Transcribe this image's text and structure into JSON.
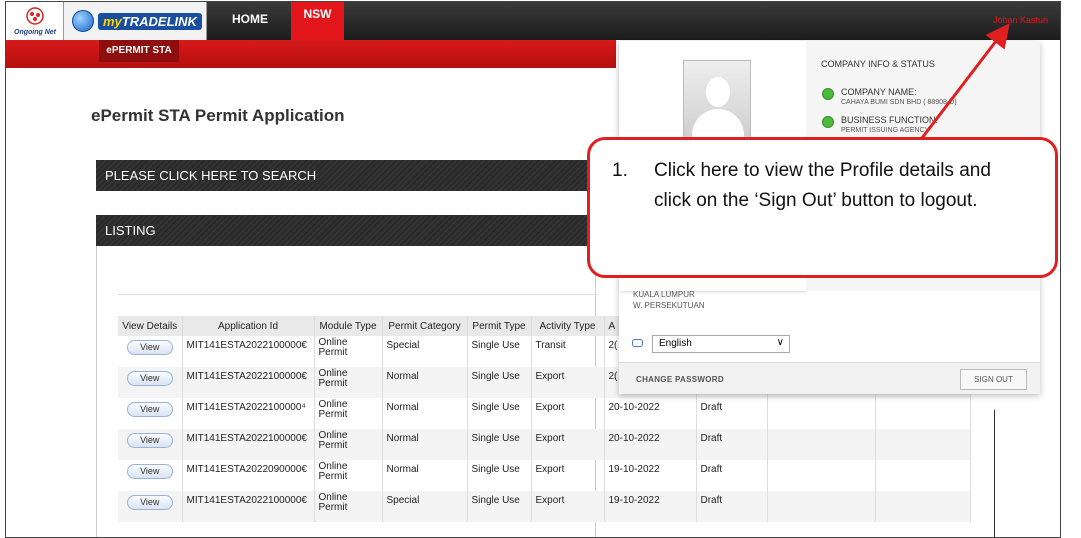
{
  "header": {
    "logo_text": "Ongoing Net",
    "brand_prefix": "my",
    "brand_name": "TRADELINK",
    "nav_home": "HOME",
    "nav_nsw": "NSW",
    "user_name": "Johan Kasturi",
    "sub_tab": "ePERMIT STA"
  },
  "page": {
    "title": "ePermit STA Permit Application",
    "search_bar": "PLEASE CLICK HERE TO SEARCH",
    "listing_bar": "LISTING"
  },
  "table": {
    "headers": [
      "View Details",
      "Application Id",
      "Module Type",
      "Permit Category",
      "Permit Type",
      "Activity Type",
      "A",
      "",
      "",
      ""
    ],
    "view_label": "View",
    "rows": [
      {
        "id": "MIT141ESTA2022100000€",
        "module": "Online Permit",
        "category": "Special",
        "ptype": "Single Use",
        "activity": "Transit",
        "date": "2(",
        "status": ""
      },
      {
        "id": "MIT141ESTA2022100000€",
        "module": "Online Permit",
        "category": "Normal",
        "ptype": "Single Use",
        "activity": "Export",
        "date": "2(",
        "status": ""
      },
      {
        "id": "MIT141ESTA2022100000⁴",
        "module": "Online Permit",
        "category": "Normal",
        "ptype": "Single Use",
        "activity": "Export",
        "date": "20-10-2022",
        "status": "Draft"
      },
      {
        "id": "MIT141ESTA2022100000€",
        "module": "Online Permit",
        "category": "Normal",
        "ptype": "Single Use",
        "activity": "Export",
        "date": "20-10-2022",
        "status": "Draft"
      },
      {
        "id": "MIT141ESTA2022090000€",
        "module": "Online Permit",
        "category": "Normal",
        "ptype": "Single Use",
        "activity": "Export",
        "date": "19-10-2022",
        "status": "Draft"
      },
      {
        "id": "MIT141ESTA2022100000€",
        "module": "Online Permit",
        "category": "Special",
        "ptype": "Single Use",
        "activity": "Export",
        "date": "19-10-2022",
        "status": "Draft"
      }
    ]
  },
  "profile": {
    "section_title": "COMPANY INFO & STATUS",
    "company_label": "COMPANY NAME:",
    "company_value": "CAHAYA BUMI SDN BHD (  88908-D)",
    "function_label": "BUSINESS FUNCTION:",
    "function_value": "PERMIT ISSUING AGENCY",
    "address_line1": "KUALA LUMPUR",
    "address_line2": "W. PERSEKUTUAN",
    "language": "English",
    "change_password": "CHANGE PASSWORD",
    "sign_out": "SIGN OUT"
  },
  "callout": {
    "number": "1.",
    "text": "Click here to view the Profile details and click on the ‘Sign Out’ button to logout.",
    "color": "#e02020"
  }
}
